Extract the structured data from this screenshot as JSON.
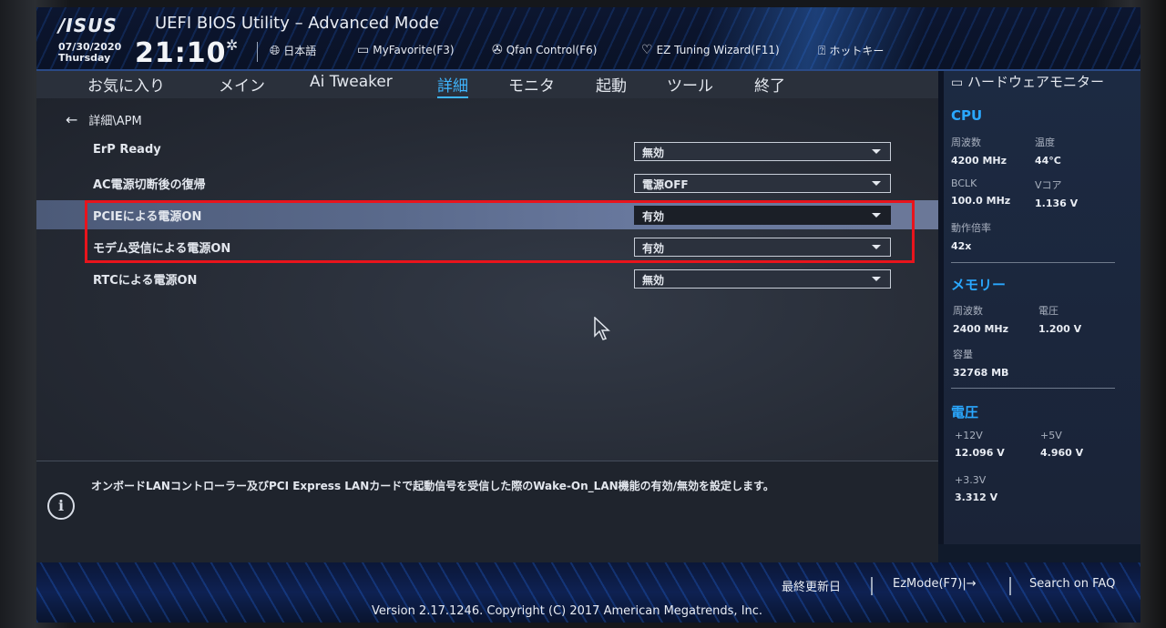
{
  "header": {
    "logo": "/ISUS",
    "title": "UEFI BIOS Utility – Advanced Mode",
    "date": "07/30/2020",
    "day": "Thursday",
    "time": "21:10",
    "tools": [
      {
        "icon": "globe-icon",
        "label": "日本語"
      },
      {
        "icon": "favorite-icon",
        "label": "MyFavorite(F3)"
      },
      {
        "icon": "fan-icon",
        "label": "Qfan Control(F6)"
      },
      {
        "icon": "bulb-icon",
        "label": "EZ Tuning Wizard(F11)"
      },
      {
        "icon": "help-icon",
        "label": "ホットキー"
      }
    ]
  },
  "nav": {
    "tabs": [
      "お気に入り",
      "メイン",
      "Ai Tweaker",
      "詳細",
      "モニタ",
      "起動",
      "ツール",
      "終了"
    ],
    "active": "詳細"
  },
  "breadcrumb": "詳細\\APM",
  "settings": [
    {
      "label": "ErP Ready",
      "value": "無効"
    },
    {
      "label": "AC電源切断後の復帰",
      "value": "電源OFF"
    },
    {
      "label": "PCIEによる電源ON",
      "value": "有効"
    },
    {
      "label": "モデム受信による電源ON",
      "value": "有効"
    },
    {
      "label": "RTCによる電源ON",
      "value": "無効"
    }
  ],
  "help": {
    "text": "オンボードLANコントローラー及びPCI Express LANカードで起動信号を受信した際のWake-On_LAN機能の有効/無効を設定します。"
  },
  "hardware_monitor": {
    "title": "ハードウェアモニター",
    "cpu": {
      "title": "CPU",
      "freq_label": "周波数",
      "freq": "4200 MHz",
      "temp_label": "温度",
      "temp": "44°C",
      "bclk_label": "BCLK",
      "bclk": "100.0 MHz",
      "vcore_label": "Vコア",
      "vcore": "1.136 V",
      "ratio_label": "動作倍率",
      "ratio": "42x"
    },
    "memory": {
      "title": "メモリー",
      "freq_label": "周波数",
      "freq": "2400 MHz",
      "volt_label": "電圧",
      "volt": "1.200 V",
      "cap_label": "容量",
      "cap": "32768 MB"
    },
    "voltage": {
      "title": "電圧",
      "v12_label": "+12V",
      "v12": "12.096 V",
      "v5_label": "+5V",
      "v5": "4.960 V",
      "v33_label": "+3.3V",
      "v33": "3.312 V"
    }
  },
  "footer": {
    "last_modified": "最終更新日",
    "ezmode": "EzMode(F7)|→",
    "search": "Search on FAQ",
    "version": "Version 2.17.1246. Copyright (C) 2017 American Megatrends, Inc."
  },
  "colors": {
    "accent": "#3fb6ff",
    "section": "#2aa8ff",
    "highlight_box": "#e8141c"
  }
}
